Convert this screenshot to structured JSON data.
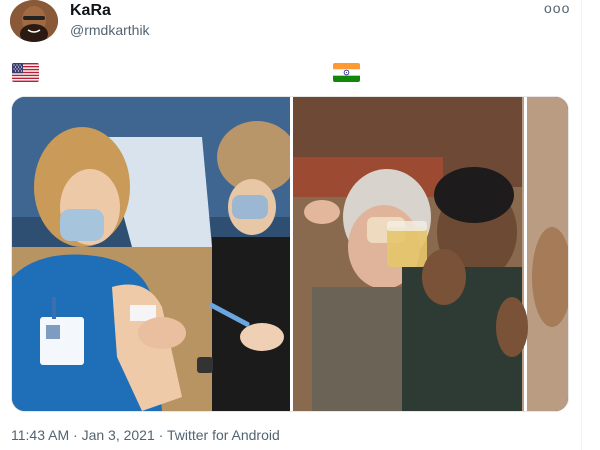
{
  "author": {
    "name": "KaRa",
    "handle": "@rmdkarthik"
  },
  "menu": {
    "icon": "more-dots-icon",
    "glyph": "ooo"
  },
  "flags": [
    {
      "country": "US",
      "icon": "us-flag-icon"
    },
    {
      "country": "India",
      "icon": "india-flag-icon"
    }
  ],
  "media": {
    "panels": [
      {
        "subject": "healthcare worker receiving vaccine injection in arm"
      },
      {
        "subject": "men drinking yellow liquid from glasses"
      }
    ]
  },
  "footer": {
    "time": "11:43 AM",
    "sep1": " · ",
    "date": "Jan 3, 2021",
    "sep2": " · ",
    "source": "Twitter for Android"
  },
  "colors": {
    "text_primary": "#0f1419",
    "text_secondary": "#536471",
    "flag_saffron": "#ff9933",
    "flag_green": "#138808",
    "flag_chakra": "#000080"
  }
}
